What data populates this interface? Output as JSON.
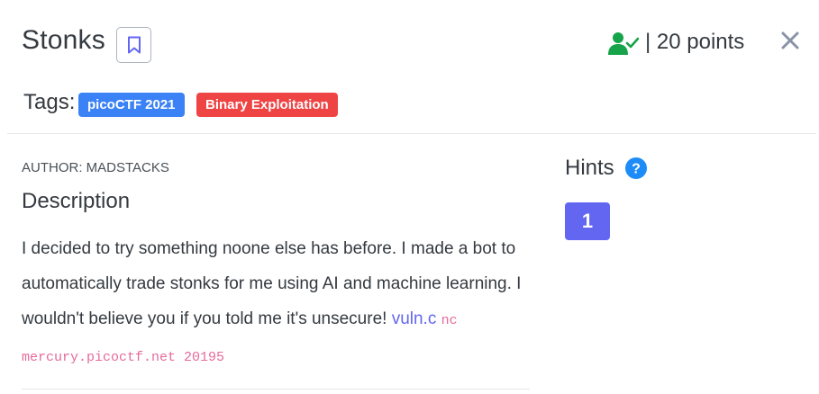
{
  "challenge": {
    "title": "Stonks",
    "points": "| 20 points"
  },
  "tags": {
    "label": "Tags:",
    "items": [
      "picoCTF 2021",
      "Binary Exploitation"
    ]
  },
  "author": "AUTHOR: MADSTACKS",
  "description": {
    "heading": "Description",
    "text": "I decided to try something noone else has before. I made a bot to automatically trade stonks for me using AI and machine learning. I wouldn't believe you if you told me it's unsecure! ",
    "link_text": "vuln.c",
    "command": "nc mercury.picoctf.net 20195"
  },
  "hints": {
    "heading": "Hints",
    "items": [
      "1"
    ]
  },
  "colors": {
    "accent": "#6366f1",
    "tag_primary": "#3b82f6",
    "tag_danger": "#ef4444",
    "solved": "#16a34a"
  },
  "icons": {
    "bookmark": "bookmark-icon",
    "solved": "user-check-icon",
    "close": "close-icon",
    "help": "question-circle-icon"
  }
}
